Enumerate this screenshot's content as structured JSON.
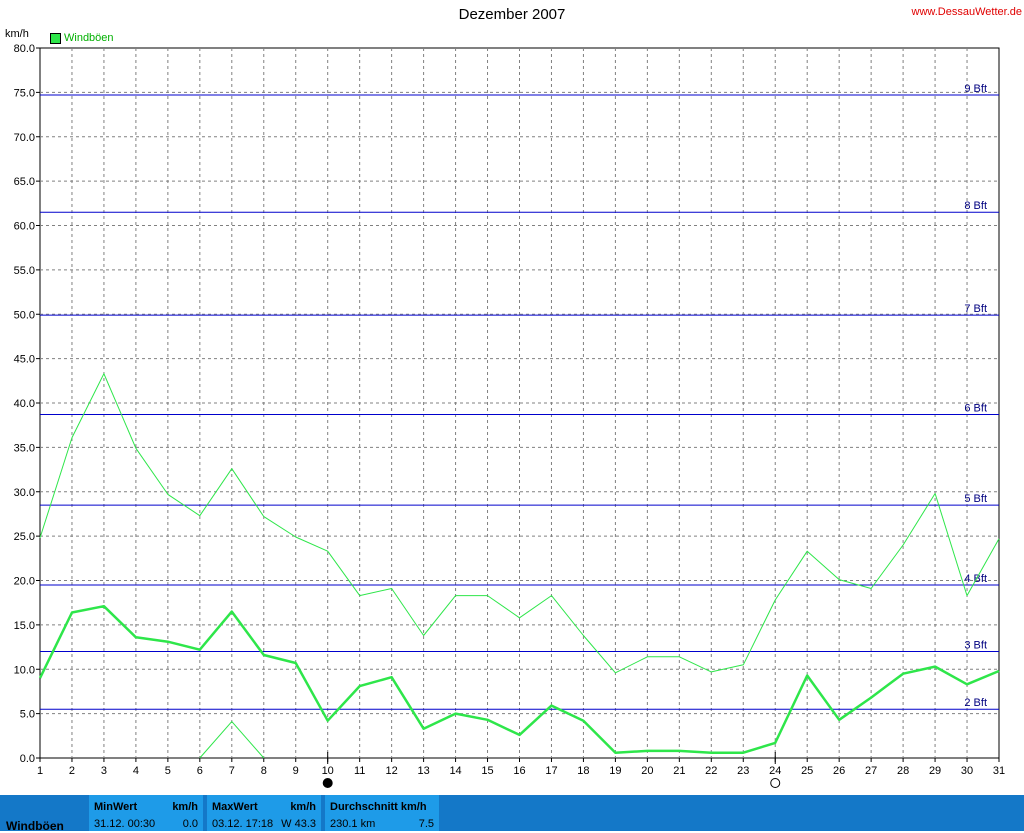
{
  "header": {
    "title": "Dezember 2007",
    "site": "www.DessauWetter.de",
    "y_unit": "km/h",
    "legend_label": "Windböen"
  },
  "stats": {
    "series_label": "Windböen",
    "min": {
      "header": "MinWert",
      "unit": "km/h",
      "time": "31.12. 00:30",
      "value": "0.0"
    },
    "max": {
      "header": "MaxWert",
      "unit": "km/h",
      "time": "03.12. 17:18",
      "value": "W 43.3"
    },
    "avg": {
      "header": "Durchschnitt km/h",
      "distance": "230.1 km",
      "value": "7.5"
    }
  },
  "colors": {
    "series": "#2ee64a",
    "bft_line": "#0000cc",
    "bft_label": "#000080",
    "grid": "#808080",
    "stats_bg": "#1478c8",
    "stats_box": "#1e9be8"
  },
  "chart_data": {
    "type": "line",
    "title": "Dezember 2007",
    "ylabel": "km/h",
    "ylim": [
      0,
      80
    ],
    "yticks": [
      "0.0",
      "5.0",
      "10.0",
      "15.0",
      "20.0",
      "25.0",
      "30.0",
      "35.0",
      "40.0",
      "45.0",
      "50.0",
      "55.0",
      "60.0",
      "65.0",
      "70.0",
      "75.0",
      "80.0"
    ],
    "x": [
      1,
      2,
      3,
      4,
      5,
      6,
      7,
      8,
      9,
      10,
      11,
      12,
      13,
      14,
      15,
      16,
      17,
      18,
      19,
      20,
      21,
      22,
      23,
      24,
      25,
      26,
      27,
      28,
      29,
      30,
      31
    ],
    "grid": true,
    "legend": "top-left",
    "series": [
      {
        "name": "Windböen",
        "role": "max",
        "width": 1,
        "values": [
          24.8,
          36.1,
          43.3,
          34.9,
          29.7,
          27.3,
          32.6,
          27.2,
          24.9,
          23.3,
          18.3,
          19.1,
          13.8,
          18.3,
          18.3,
          15.8,
          18.3,
          13.8,
          9.6,
          11.4,
          11.4,
          9.7,
          10.5,
          17.8,
          23.3,
          20.1,
          19.1,
          24.0,
          29.8,
          18.3,
          24.7
        ]
      },
      {
        "name": "Windböen",
        "role": "average",
        "width": 2.5,
        "values": [
          9.0,
          16.4,
          17.1,
          13.6,
          13.1,
          12.2,
          16.5,
          11.6,
          10.7,
          4.2,
          8.1,
          9.1,
          3.3,
          5.0,
          4.3,
          2.6,
          5.9,
          4.2,
          0.6,
          0.8,
          0.8,
          0.6,
          0.6,
          1.7,
          9.3,
          4.3,
          6.8,
          9.5,
          10.3,
          8.3,
          9.8
        ]
      },
      {
        "name": "Windböen",
        "role": "min",
        "width": 1,
        "x": [
          6,
          7,
          8
        ],
        "values": [
          0.0,
          4.1,
          0.0
        ]
      }
    ],
    "beaufort": [
      {
        "label": "2 Bft",
        "value": 5.5
      },
      {
        "label": "3 Bft",
        "value": 12.0
      },
      {
        "label": "4 Bft",
        "value": 19.5
      },
      {
        "label": "5 Bft",
        "value": 28.5
      },
      {
        "label": "6 Bft",
        "value": 38.7
      },
      {
        "label": "7 Bft",
        "value": 49.9
      },
      {
        "label": "8 Bft",
        "value": 61.5
      },
      {
        "label": "9 Bft",
        "value": 74.7
      }
    ],
    "moon": {
      "new_moon_day": 10,
      "full_moon_day": 24
    }
  }
}
